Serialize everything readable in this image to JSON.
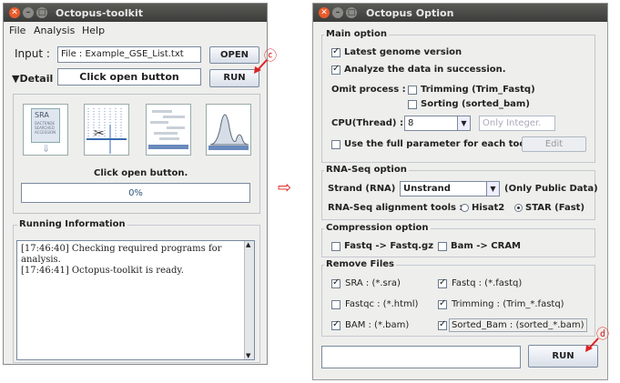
{
  "left_window": {
    "title": "Octopus-toolkit",
    "menu": [
      "File",
      "Analysis",
      "Help"
    ],
    "input_label": "Input :",
    "input_value": "File : Example_GSE_List.txt",
    "open_button": "OPEN",
    "detail_toggle": "▼Detail",
    "status_field": "Click open button",
    "run_button": "RUN",
    "tiles": [
      {
        "name": "sra-tile",
        "caption": "SRA",
        "sub": [
          "DACTENDE",
          "SEARCHED",
          "ACCESSION"
        ]
      },
      {
        "name": "trimming-tile"
      },
      {
        "name": "alignment-tile"
      },
      {
        "name": "peak-tile"
      }
    ],
    "progress_caption": "Click open button.",
    "progress_value": 0,
    "progress_label": "0%",
    "running_title": "Running Information",
    "log_lines": [
      "[17:46:40] Checking required programs for",
      "analysis.",
      "[17:46:41] Octopus-toolkit is ready."
    ]
  },
  "annotations": {
    "c": "ⓒ",
    "d": "ⓓ",
    "arrow": "⇨"
  },
  "right_window": {
    "title": "Octopus Option",
    "main_option": {
      "title": "Main option",
      "latest_genome": {
        "label": "Latest genome version",
        "checked": true
      },
      "succession": {
        "label": "Analyze the data in succession.",
        "checked": true
      },
      "omit_label": "Omit process :",
      "trimming": {
        "label": "Trimming (Trim_Fastq)",
        "checked": false
      },
      "sorting": {
        "label": "Sorting (sorted_bam)",
        "checked": false
      },
      "cpu_label": "CPU(Thread) :",
      "cpu_value": "8",
      "cpu_placeholder": "Only Integer.",
      "full_param": {
        "label": "Use the full parameter for each tool.",
        "checked": false
      },
      "edit_button": "Edit"
    },
    "rnaseq_option": {
      "title": "RNA-Seq option",
      "strand_label": "Strand (RNA) :",
      "strand_value": "Unstrand",
      "strand_note": "(Only Public Data)",
      "align_label": "RNA-Seq alignment tools :",
      "hisat2": "Hisat2",
      "star": "STAR (Fast)",
      "selected": "STAR (Fast)"
    },
    "compression_option": {
      "title": "Compression option",
      "fastq_gz": {
        "label": "Fastq -> Fastq.gz",
        "checked": false
      },
      "bam_cram": {
        "label": "Bam -> CRAM",
        "checked": false
      }
    },
    "remove_files": {
      "title": "Remove Files",
      "items": [
        {
          "label": "SRA : (*.sra)",
          "checked": true
        },
        {
          "label": "Fastq : (*.fastq)",
          "checked": true
        },
        {
          "label": "Fastqc : (*.html)",
          "checked": false
        },
        {
          "label": "Trimming : (Trim_*.fastq)",
          "checked": true
        },
        {
          "label": "BAM : (*.bam)",
          "checked": true
        },
        {
          "label": "Sorted_Bam : (sorted_*.bam)",
          "checked": true
        }
      ]
    },
    "bottom_field": "",
    "run_button": "RUN"
  }
}
